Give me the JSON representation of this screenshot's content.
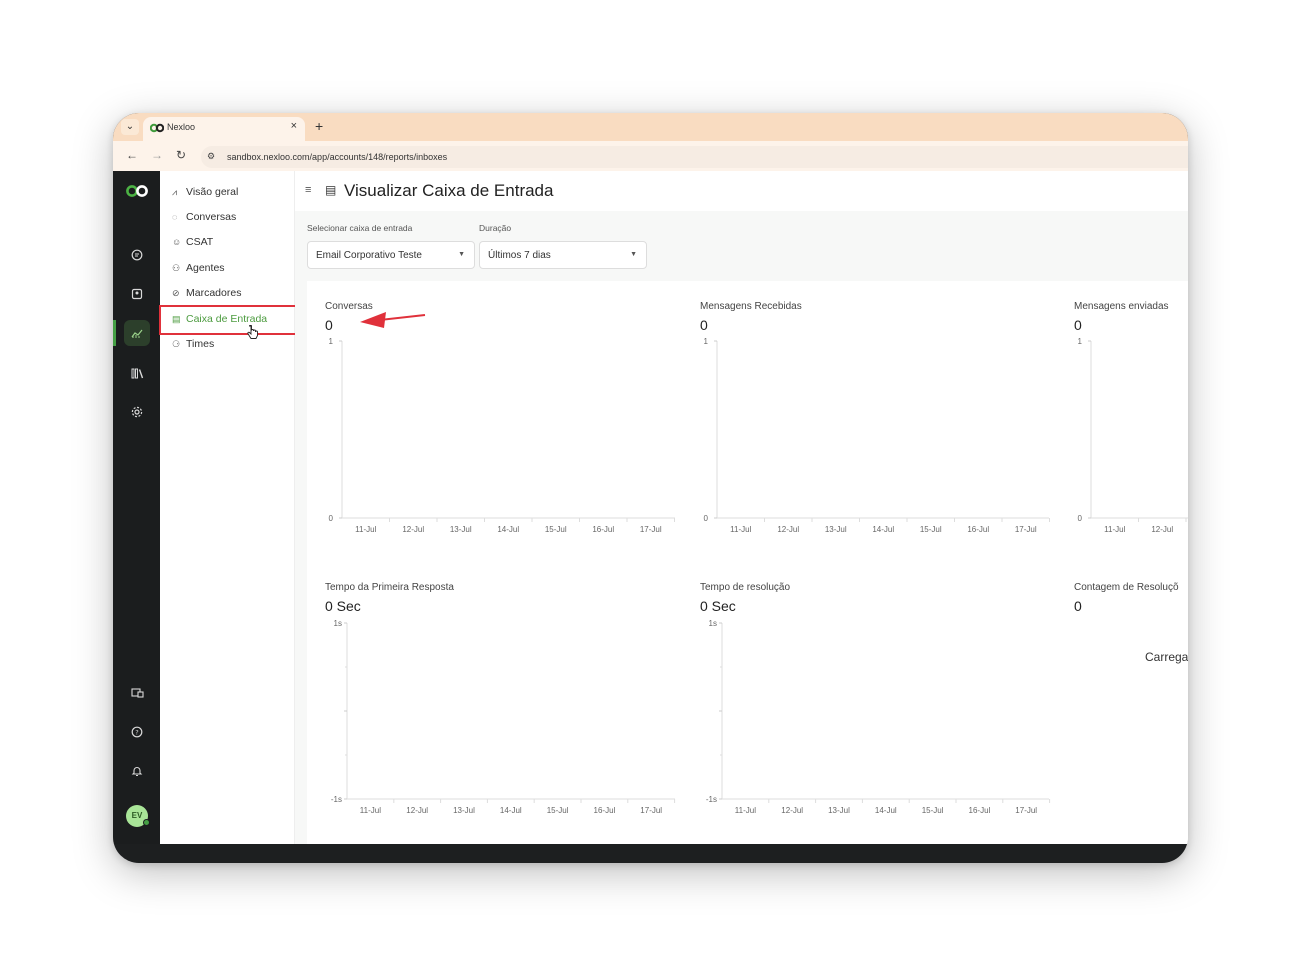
{
  "browser": {
    "tab_title": "Nexloo",
    "tab_close": "×",
    "new_tab": "+",
    "tab_menu": "⌄",
    "url": "sandbox.nexloo.com/app/accounts/148/reports/inboxes"
  },
  "subnav": {
    "items": [
      {
        "label": "Visão geral",
        "icon": "chart-icon"
      },
      {
        "label": "Conversas",
        "icon": "chat-icon"
      },
      {
        "label": "CSAT",
        "icon": "smile-icon"
      },
      {
        "label": "Agentes",
        "icon": "people-icon"
      },
      {
        "label": "Marcadores",
        "icon": "tag-icon"
      },
      {
        "label": "Caixa de Entrada",
        "icon": "inbox-icon"
      },
      {
        "label": "Times",
        "icon": "team-icon"
      }
    ],
    "active_index": 5
  },
  "user": {
    "initials": "EV"
  },
  "header": {
    "title": "Visualizar Caixa de Entrada"
  },
  "filters": {
    "inbox_label": "Selecionar caixa de entrada",
    "inbox_value": "Email Corporativo Teste",
    "duration_label": "Duração",
    "duration_value": "Últimos 7 dias"
  },
  "cards": {
    "conversas": {
      "title": "Conversas",
      "value": "0"
    },
    "recebidas": {
      "title": "Mensagens Recebidas",
      "value": "0"
    },
    "enviadas": {
      "title": "Mensagens enviadas",
      "value": "0"
    },
    "primeira": {
      "title": "Tempo da Primeira Resposta",
      "value": "0 Sec"
    },
    "resolucao": {
      "title": "Tempo de resolução",
      "value": "0 Sec"
    },
    "contagem": {
      "title": "Contagem de Resoluçõ",
      "value": "0"
    },
    "loading": "Carrega"
  },
  "chart_data": [
    {
      "type": "bar",
      "categories": [
        "11-Jul",
        "12-Jul",
        "13-Jul",
        "14-Jul",
        "15-Jul",
        "16-Jul",
        "17-Jul"
      ],
      "yticks": [
        "0",
        "1"
      ],
      "ylim": [
        0,
        1
      ]
    },
    {
      "type": "bar",
      "categories": [
        "11-Jul",
        "12-Jul",
        "13-Jul",
        "14-Jul",
        "15-Jul",
        "16-Jul",
        "17-Jul"
      ],
      "yticks": [
        "0",
        "1"
      ],
      "ylim": [
        0,
        1
      ]
    },
    {
      "type": "bar",
      "categories": [
        "11-Jul",
        "12-Jul"
      ],
      "yticks": [
        "0",
        "1"
      ],
      "ylim": [
        0,
        1
      ]
    },
    {
      "type": "bar",
      "categories": [
        "11-Jul",
        "12-Jul",
        "13-Jul",
        "14-Jul",
        "15-Jul",
        "16-Jul",
        "17-Jul"
      ],
      "yticks": [
        "-1s",
        "1s"
      ],
      "ylim": [
        -1,
        1
      ]
    },
    {
      "type": "bar",
      "categories": [
        "11-Jul",
        "12-Jul",
        "13-Jul",
        "14-Jul",
        "15-Jul",
        "16-Jul",
        "17-Jul"
      ],
      "yticks": [
        "-1s",
        "1s"
      ],
      "ylim": [
        -1,
        1
      ]
    }
  ],
  "colors": {
    "accent": "#4c9b3f",
    "annotation": "#e0313b",
    "tabbar": "#f9dcc1"
  }
}
